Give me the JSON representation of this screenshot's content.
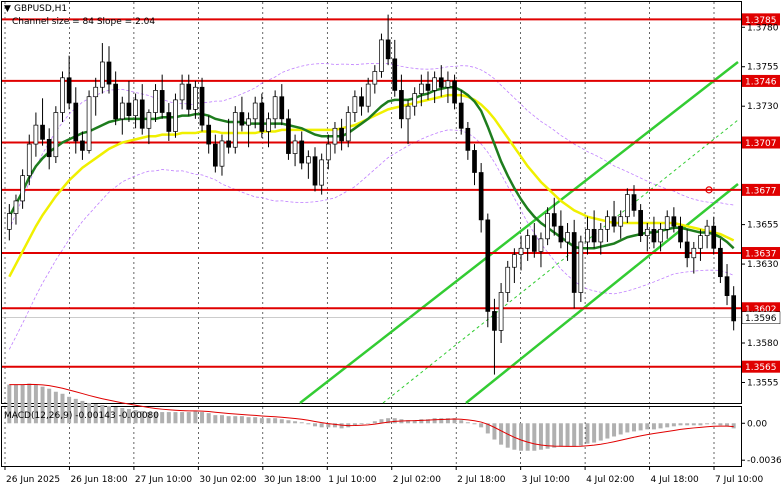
{
  "header": {
    "symbol": "GBPUSD,H1",
    "channel_info": "Channel size = 84 Slope = 2.04"
  },
  "macd": {
    "label": "MACD(12,26,9) -0.00143 -0.00080"
  },
  "colors": {
    "level": "#e00000",
    "channel": "#33cc33",
    "ma_fast": "#1e7d1e",
    "ma_slow": "#f0f000",
    "bollinger": "#c080ff",
    "candle": "#000000",
    "level_label_bg": "#e00000",
    "current_label_bg": "#ffffff"
  },
  "chart_data": {
    "type": "candlestick",
    "ylim": [
      1.3542,
      1.3796
    ],
    "y_ticks": [
      "1.3780",
      "1.3755",
      "1.3730",
      "1.3655",
      "1.3630",
      "1.3580",
      "1.3555"
    ],
    "x_ticks": [
      "26 Jun 2025",
      "26 Jun 18:00",
      "27 Jun 10:00",
      "30 Jun 02:00",
      "30 Jun 18:00",
      "1 Jul 10:00",
      "2 Jul 02:00",
      "2 Jul 18:00",
      "3 Jul 10:00",
      "4 Jul 02:00",
      "4 Jul 18:00",
      "7 Jul 10:00"
    ],
    "levels": [
      {
        "label": "1.3785",
        "value": 1.3785
      },
      {
        "label": "1.3746",
        "value": 1.3746
      },
      {
        "label": "1.3707",
        "value": 1.3707
      },
      {
        "label": "1.3677",
        "value": 1.3677
      },
      {
        "label": "1.3637",
        "value": 1.3637
      },
      {
        "label": "1.3602",
        "value": 1.3602
      },
      {
        "label": "1.3565",
        "value": 1.3565
      }
    ],
    "current_price": {
      "label": "1.3596",
      "value": 1.3596
    },
    "candles": [
      [
        1.3652,
        1.3668,
        1.3645,
        1.3662
      ],
      [
        1.3662,
        1.3674,
        1.3655,
        1.367
      ],
      [
        1.367,
        1.369,
        1.3665,
        1.3686
      ],
      [
        1.3686,
        1.3712,
        1.368,
        1.3706
      ],
      [
        1.3706,
        1.3726,
        1.3698,
        1.3718
      ],
      [
        1.3718,
        1.3735,
        1.3705,
        1.3709
      ],
      [
        1.3709,
        1.3716,
        1.369,
        1.3698
      ],
      [
        1.3698,
        1.373,
        1.3694,
        1.3726
      ],
      [
        1.3726,
        1.3752,
        1.372,
        1.3748
      ],
      [
        1.3748,
        1.3762,
        1.3728,
        1.3732
      ],
      [
        1.3732,
        1.3742,
        1.37,
        1.3708
      ],
      [
        1.3708,
        1.3714,
        1.3696,
        1.3702
      ],
      [
        1.3702,
        1.374,
        1.37,
        1.3736
      ],
      [
        1.3736,
        1.3748,
        1.3724,
        1.3742
      ],
      [
        1.3742,
        1.377,
        1.3738,
        1.3758
      ],
      [
        1.3758,
        1.3768,
        1.3738,
        1.3744
      ],
      [
        1.3744,
        1.3752,
        1.3718,
        1.3722
      ],
      [
        1.3722,
        1.3736,
        1.3712,
        1.3732
      ],
      [
        1.3732,
        1.3746,
        1.372,
        1.3724
      ],
      [
        1.3724,
        1.3738,
        1.3716,
        1.3734
      ],
      [
        1.3734,
        1.3744,
        1.3712,
        1.3716
      ],
      [
        1.3716,
        1.3728,
        1.3706,
        1.3726
      ],
      [
        1.3726,
        1.3744,
        1.372,
        1.374
      ],
      [
        1.374,
        1.375,
        1.3722,
        1.3726
      ],
      [
        1.3726,
        1.3732,
        1.3708,
        1.3714
      ],
      [
        1.3714,
        1.3738,
        1.371,
        1.3734
      ],
      [
        1.3734,
        1.375,
        1.3728,
        1.3744
      ],
      [
        1.3744,
        1.375,
        1.3724,
        1.3728
      ],
      [
        1.3728,
        1.3746,
        1.3722,
        1.3742
      ],
      [
        1.3742,
        1.3748,
        1.3714,
        1.3718
      ],
      [
        1.3718,
        1.3724,
        1.37,
        1.3706
      ],
      [
        1.3706,
        1.3712,
        1.3688,
        1.3692
      ],
      [
        1.3692,
        1.3712,
        1.3686,
        1.3708
      ],
      [
        1.3708,
        1.3722,
        1.37,
        1.3704
      ],
      [
        1.3704,
        1.373,
        1.37,
        1.3726
      ],
      [
        1.3726,
        1.3736,
        1.3714,
        1.3718
      ],
      [
        1.3718,
        1.3726,
        1.3704,
        1.3722
      ],
      [
        1.3722,
        1.3736,
        1.3716,
        1.3732
      ],
      [
        1.3732,
        1.3738,
        1.371,
        1.3714
      ],
      [
        1.3714,
        1.3726,
        1.3704,
        1.3722
      ],
      [
        1.3722,
        1.374,
        1.3716,
        1.3736
      ],
      [
        1.3736,
        1.3744,
        1.3718,
        1.3722
      ],
      [
        1.3722,
        1.3728,
        1.3696,
        1.37
      ],
      [
        1.37,
        1.3712,
        1.3692,
        1.3708
      ],
      [
        1.3708,
        1.3714,
        1.369,
        1.3694
      ],
      [
        1.3694,
        1.3702,
        1.3684,
        1.3698
      ],
      [
        1.3698,
        1.3704,
        1.3676,
        1.368
      ],
      [
        1.368,
        1.37,
        1.3674,
        1.3696
      ],
      [
        1.3696,
        1.3712,
        1.369,
        1.3706
      ],
      [
        1.3706,
        1.372,
        1.37,
        1.3716
      ],
      [
        1.3716,
        1.3722,
        1.3702,
        1.3708
      ],
      [
        1.3708,
        1.373,
        1.3704,
        1.3726
      ],
      [
        1.3726,
        1.374,
        1.372,
        1.3736
      ],
      [
        1.3736,
        1.3742,
        1.3724,
        1.373
      ],
      [
        1.373,
        1.3748,
        1.3726,
        1.3744
      ],
      [
        1.3744,
        1.3756,
        1.3738,
        1.3752
      ],
      [
        1.3752,
        1.3776,
        1.3748,
        1.3772
      ],
      [
        1.3772,
        1.3788,
        1.3756,
        1.376
      ],
      [
        1.376,
        1.3772,
        1.3736,
        1.374
      ],
      [
        1.374,
        1.375,
        1.3716,
        1.3722
      ],
      [
        1.3722,
        1.3734,
        1.3706,
        1.373
      ],
      [
        1.373,
        1.3742,
        1.3724,
        1.3738
      ],
      [
        1.3738,
        1.375,
        1.373,
        1.3744
      ],
      [
        1.3744,
        1.3752,
        1.3734,
        1.374
      ],
      [
        1.374,
        1.3752,
        1.3732,
        1.3748
      ],
      [
        1.3748,
        1.3756,
        1.3736,
        1.3742
      ],
      [
        1.3742,
        1.3752,
        1.3732,
        1.3746
      ],
      [
        1.3746,
        1.375,
        1.3728,
        1.3732
      ],
      [
        1.3732,
        1.374,
        1.3712,
        1.3716
      ],
      [
        1.3716,
        1.372,
        1.3696,
        1.3702
      ],
      [
        1.3702,
        1.3706,
        1.368,
        1.3688
      ],
      [
        1.3688,
        1.3694,
        1.365,
        1.3658
      ],
      [
        1.3658,
        1.3662,
        1.359,
        1.36
      ],
      [
        1.36,
        1.3608,
        1.356,
        1.3588
      ],
      [
        1.3588,
        1.3618,
        1.358,
        1.3612
      ],
      [
        1.3612,
        1.3632,
        1.3606,
        1.3628
      ],
      [
        1.3628,
        1.364,
        1.3618,
        1.3636
      ],
      [
        1.3636,
        1.3648,
        1.3626,
        1.364
      ],
      [
        1.364,
        1.3652,
        1.3632,
        1.3648
      ],
      [
        1.3648,
        1.3656,
        1.3634,
        1.3638
      ],
      [
        1.3638,
        1.365,
        1.3628,
        1.3646
      ],
      [
        1.3646,
        1.3666,
        1.3642,
        1.3662
      ],
      [
        1.3662,
        1.3672,
        1.3648,
        1.3654
      ],
      [
        1.3654,
        1.3664,
        1.364,
        1.3644
      ],
      [
        1.3644,
        1.3656,
        1.3632,
        1.365
      ],
      [
        1.365,
        1.3658,
        1.3602,
        1.3612
      ],
      [
        1.3612,
        1.3648,
        1.3606,
        1.3644
      ],
      [
        1.3644,
        1.366,
        1.3636,
        1.3652
      ],
      [
        1.3652,
        1.3664,
        1.364,
        1.3644
      ],
      [
        1.3644,
        1.3656,
        1.3636,
        1.3652
      ],
      [
        1.3652,
        1.3664,
        1.3644,
        1.366
      ],
      [
        1.366,
        1.367,
        1.365,
        1.3654
      ],
      [
        1.3654,
        1.3664,
        1.3646,
        1.366
      ],
      [
        1.366,
        1.3678,
        1.3656,
        1.3674
      ],
      [
        1.3674,
        1.368,
        1.366,
        1.3664
      ],
      [
        1.3664,
        1.3668,
        1.3644,
        1.3648
      ],
      [
        1.3648,
        1.3656,
        1.3638,
        1.3652
      ],
      [
        1.3652,
        1.366,
        1.364,
        1.3644
      ],
      [
        1.3644,
        1.3656,
        1.3638,
        1.3652
      ],
      [
        1.3652,
        1.3664,
        1.3646,
        1.366
      ],
      [
        1.366,
        1.3666,
        1.365,
        1.3654
      ],
      [
        1.3654,
        1.366,
        1.364,
        1.3644
      ],
      [
        1.3644,
        1.3652,
        1.3628,
        1.3634
      ],
      [
        1.3634,
        1.3644,
        1.3624,
        1.364
      ],
      [
        1.364,
        1.3652,
        1.3632,
        1.3648
      ],
      [
        1.3648,
        1.3658,
        1.364,
        1.3654
      ],
      [
        1.3654,
        1.366,
        1.3636,
        1.364
      ],
      [
        1.364,
        1.3646,
        1.3618,
        1.3622
      ],
      [
        1.3622,
        1.363,
        1.3604,
        1.361
      ],
      [
        1.361,
        1.3616,
        1.3588,
        1.3594
      ]
    ],
    "ma_fast": [
      1.366,
      1.3668,
      1.3676,
      1.3685,
      1.3692,
      1.3697,
      1.3701,
      1.3704,
      1.3707,
      1.3709,
      1.3711,
      1.3713,
      1.3714,
      1.3716,
      1.3718,
      1.372,
      1.3721,
      1.3722,
      1.3722,
      1.3722,
      1.3722,
      1.3722,
      1.3722,
      1.3723,
      1.3723,
      1.3723,
      1.3724,
      1.3724,
      1.3725,
      1.3725,
      1.3724,
      1.3722,
      1.3721,
      1.372,
      1.372,
      1.372,
      1.3719,
      1.3719,
      1.3719,
      1.3719,
      1.3719,
      1.3719,
      1.3718,
      1.3717,
      1.3716,
      1.3714,
      1.3712,
      1.3711,
      1.3711,
      1.3711,
      1.3711,
      1.3713,
      1.3716,
      1.3719,
      1.3722,
      1.3726,
      1.373,
      1.3733,
      1.3734,
      1.3734,
      1.3734,
      1.3735,
      1.3737,
      1.3738,
      1.374,
      1.3741,
      1.3742,
      1.3742,
      1.374,
      1.3737,
      1.3733,
      1.3727,
      1.3717,
      1.3706,
      1.3695,
      1.3686,
      1.3678,
      1.3671,
      1.3665,
      1.366,
      1.3656,
      1.3653,
      1.365,
      1.3647,
      1.3644,
      1.3641,
      1.364,
      1.364,
      1.364,
      1.3641,
      1.3642,
      1.3643,
      1.3645,
      1.3647,
      1.3648,
      1.3649,
      1.365,
      1.365,
      1.3651,
      1.3652,
      1.3653,
      1.3653,
      1.3652,
      1.3651,
      1.365,
      1.365,
      1.3649,
      1.3647,
      1.3644,
      1.364
    ],
    "ma_slow": [
      1.3622,
      1.363,
      1.3638,
      1.3646,
      1.3654,
      1.3661,
      1.3667,
      1.3673,
      1.3678,
      1.3683,
      1.3687,
      1.3691,
      1.3694,
      1.3697,
      1.37,
      1.3703,
      1.3705,
      1.3707,
      1.3708,
      1.3709,
      1.371,
      1.3711,
      1.3711,
      1.3712,
      1.3712,
      1.3712,
      1.3713,
      1.3713,
      1.3713,
      1.3714,
      1.3714,
      1.3714,
      1.3713,
      1.3713,
      1.3713,
      1.3713,
      1.3713,
      1.3713,
      1.3714,
      1.3714,
      1.3714,
      1.3715,
      1.3715,
      1.3715,
      1.3715,
      1.3715,
      1.3715,
      1.3715,
      1.3715,
      1.3715,
      1.3716,
      1.3717,
      1.3718,
      1.372,
      1.3722,
      1.3724,
      1.3726,
      1.3728,
      1.3729,
      1.373,
      1.3731,
      1.3732,
      1.3733,
      1.3734,
      1.3735,
      1.3736,
      1.3737,
      1.3737,
      1.3737,
      1.3736,
      1.3734,
      1.3731,
      1.3727,
      1.3722,
      1.3716,
      1.371,
      1.3704,
      1.3698,
      1.3692,
      1.3687,
      1.3682,
      1.3678,
      1.3674,
      1.367,
      1.3667,
      1.3664,
      1.3662,
      1.366,
      1.3659,
      1.3658,
      1.3657,
      1.3656,
      1.3656,
      1.3656,
      1.3656,
      1.3656,
      1.3656,
      1.3656,
      1.3656,
      1.3656,
      1.3656,
      1.3655,
      1.3654,
      1.3653,
      1.3652,
      1.3651,
      1.365,
      1.3649,
      1.3647,
      1.3645
    ],
    "macd_ylim": [
      -0.0042,
      0.0016
    ],
    "macd_ticks": [
      "0.00",
      "-0.00363"
    ]
  }
}
